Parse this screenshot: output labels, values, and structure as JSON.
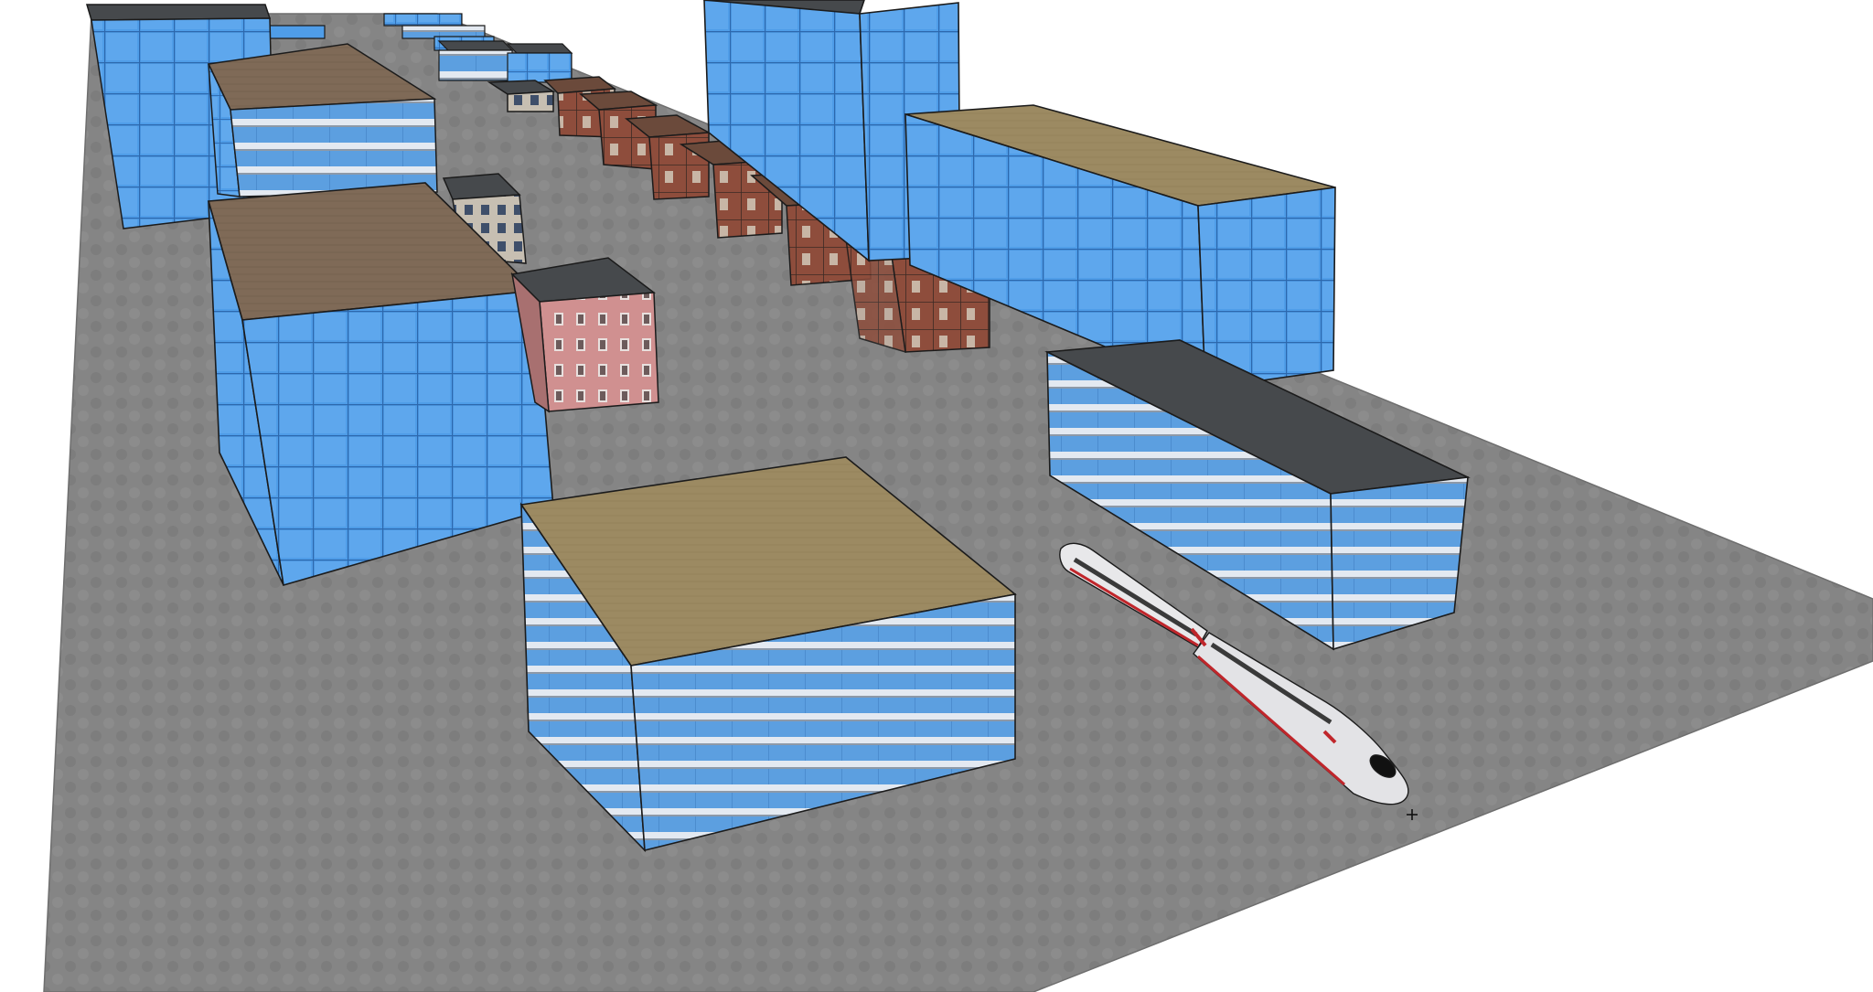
{
  "viewport": {
    "kind": "3d-model-view",
    "background": "#ffffff",
    "ground_color": "#858585",
    "cursor": "crosshair"
  },
  "palette": {
    "glass_blue": "#4d9ae6",
    "glass_blue_light": "#7cb9f2",
    "glass_grid": "#2e6bb0",
    "stripe_white": "#dfe6ef",
    "roof_brown": "#7f6a57",
    "roof_khaki": "#9c8a62",
    "roof_dark": "#46494c",
    "brick": "#8a4a3a",
    "brick_window": "#c9b7a8",
    "pink_facade": "#c98a8a",
    "train_body": "#e8e8ea",
    "train_stripe": "#c0262b",
    "edge": "#1b1b1b"
  },
  "scene": {
    "objects": [
      {
        "name": "tall-glass-tower-left-back",
        "material": "glass"
      },
      {
        "name": "brown-roof-striped-office",
        "material": "glass-striped"
      },
      {
        "name": "small-dark-roof-block",
        "material": "mixed"
      },
      {
        "name": "large-glass-cube-brown-roof",
        "material": "glass"
      },
      {
        "name": "pink-classic-facade-building",
        "material": "pink-facade"
      },
      {
        "name": "brick-apartment-row",
        "material": "brick",
        "count": 6
      },
      {
        "name": "tall-glass-tower-center",
        "material": "glass"
      },
      {
        "name": "long-glass-block-khaki-roof",
        "material": "glass"
      },
      {
        "name": "dark-roof-striped-office-right",
        "material": "glass-striped"
      },
      {
        "name": "khaki-roof-striped-office-front",
        "material": "glass-striped"
      },
      {
        "name": "high-speed-train",
        "material": "train"
      }
    ]
  }
}
